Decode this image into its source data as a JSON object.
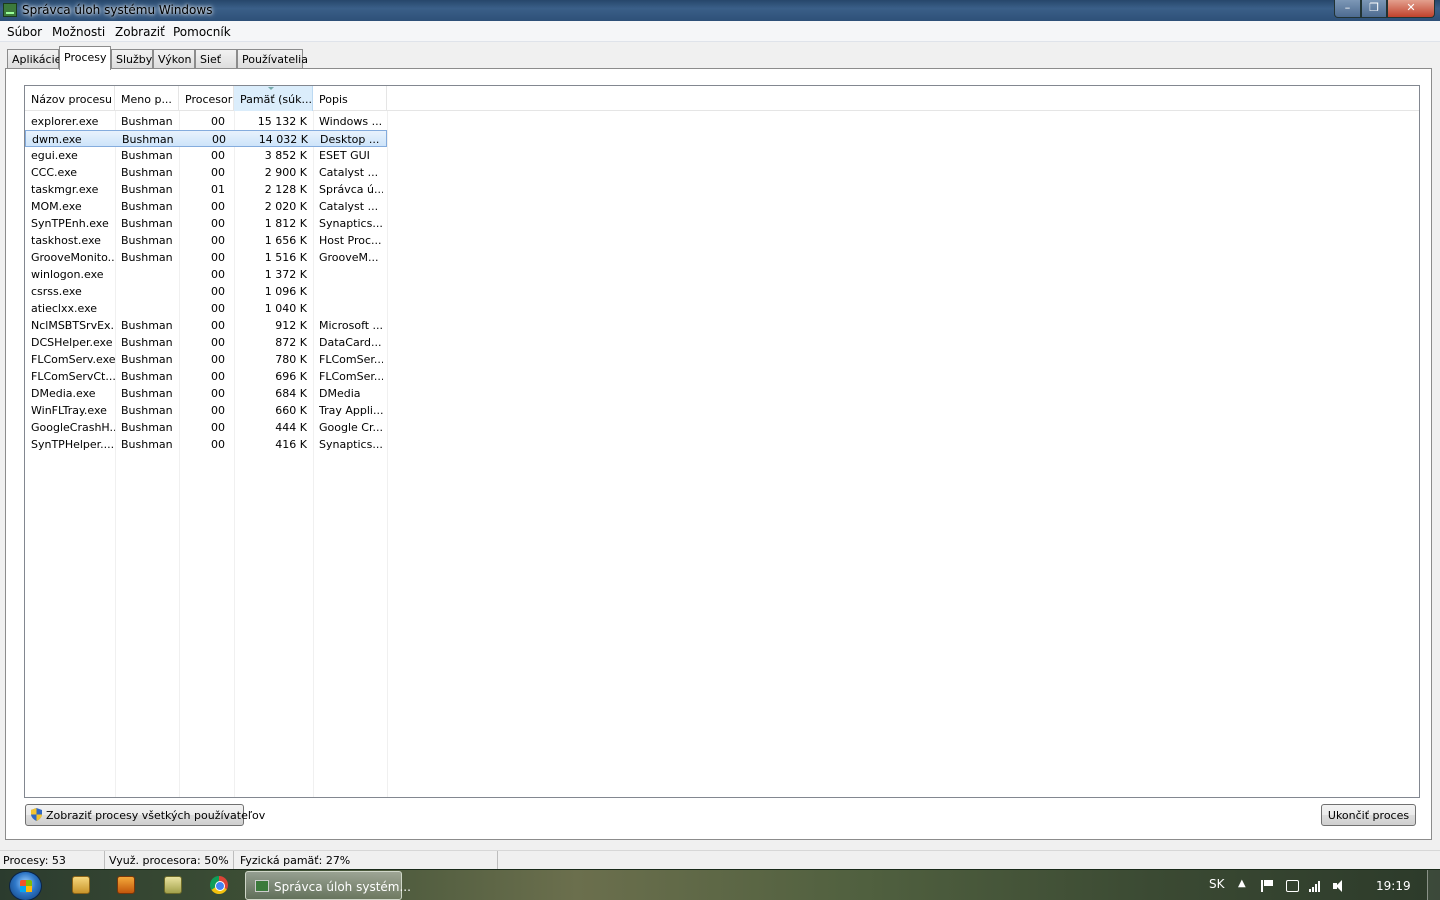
{
  "window": {
    "title": "Správca úloh systému Windows"
  },
  "menu": [
    "Súbor",
    "Možnosti",
    "Zobraziť",
    "Pomocník"
  ],
  "tabs": [
    "Aplikácie",
    "Procesy",
    "Služby",
    "Výkon",
    "Sieť",
    "Používatelia"
  ],
  "active_tab": "Procesy",
  "columns": [
    "Názov procesu",
    "Meno p...",
    "Procesor",
    "Pamäť (súk...",
    "Popis"
  ],
  "sorted_column": "Pamäť (súk...",
  "processes": [
    {
      "name": "explorer.exe",
      "user": "Bushman",
      "cpu": "00",
      "memory": "15 132 K",
      "description": "Windows ..."
    },
    {
      "name": "dwm.exe",
      "user": "Bushman",
      "cpu": "00",
      "memory": "14 032 K",
      "description": "Desktop ..."
    },
    {
      "name": "egui.exe",
      "user": "Bushman",
      "cpu": "00",
      "memory": "3 852 K",
      "description": "ESET GUI"
    },
    {
      "name": "CCC.exe",
      "user": "Bushman",
      "cpu": "00",
      "memory": "2 900 K",
      "description": "Catalyst ..."
    },
    {
      "name": "taskmgr.exe",
      "user": "Bushman",
      "cpu": "01",
      "memory": "2 128 K",
      "description": "Správca ú..."
    },
    {
      "name": "MOM.exe",
      "user": "Bushman",
      "cpu": "00",
      "memory": "2 020 K",
      "description": "Catalyst ..."
    },
    {
      "name": "SynTPEnh.exe",
      "user": "Bushman",
      "cpu": "00",
      "memory": "1 812 K",
      "description": "Synaptics..."
    },
    {
      "name": "taskhost.exe",
      "user": "Bushman",
      "cpu": "00",
      "memory": "1 656 K",
      "description": "Host Proc..."
    },
    {
      "name": "GrooveMonito...",
      "user": "Bushman",
      "cpu": "00",
      "memory": "1 516 K",
      "description": "GrooveM..."
    },
    {
      "name": "winlogon.exe",
      "user": "",
      "cpu": "00",
      "memory": "1 372 K",
      "description": ""
    },
    {
      "name": "csrss.exe",
      "user": "",
      "cpu": "00",
      "memory": "1 096 K",
      "description": ""
    },
    {
      "name": "atieclxx.exe",
      "user": "",
      "cpu": "00",
      "memory": "1 040 K",
      "description": ""
    },
    {
      "name": "NclMSBTSrvEx...",
      "user": "Bushman",
      "cpu": "00",
      "memory": "912 K",
      "description": "Microsoft ..."
    },
    {
      "name": "DCSHelper.exe",
      "user": "Bushman",
      "cpu": "00",
      "memory": "872 K",
      "description": "DataCard..."
    },
    {
      "name": "FLComServ.exe",
      "user": "Bushman",
      "cpu": "00",
      "memory": "780 K",
      "description": "FLComSer..."
    },
    {
      "name": "FLComServCt...",
      "user": "Bushman",
      "cpu": "00",
      "memory": "696 K",
      "description": "FLComSer..."
    },
    {
      "name": "DMedia.exe",
      "user": "Bushman",
      "cpu": "00",
      "memory": "684 K",
      "description": "DMedia"
    },
    {
      "name": "WinFLTray.exe",
      "user": "Bushman",
      "cpu": "00",
      "memory": "660 K",
      "description": "Tray Appli..."
    },
    {
      "name": "GoogleCrashH...",
      "user": "Bushman",
      "cpu": "00",
      "memory": "444 K",
      "description": "Google Cr..."
    },
    {
      "name": "SynTPHelper....",
      "user": "Bushman",
      "cpu": "00",
      "memory": "416 K",
      "description": "Synaptics..."
    }
  ],
  "selected_process": "dwm.exe",
  "buttons": {
    "show_all": "Zobraziť procesy všetkých používateľov",
    "end_process": "Ukončiť proces"
  },
  "status": {
    "processes": "Procesy: 53",
    "cpu": "Využ. procesora: 50%",
    "memory": "Fyzická pamäť: 27%"
  },
  "taskbar": {
    "active_task": "Správca úloh systém...",
    "language": "SK",
    "clock": "19:19"
  },
  "icons": [
    "task-manager-icon",
    "windows-start-icon",
    "explorer-icon",
    "media-player-icon",
    "libraries-icon",
    "chrome-icon",
    "shield-icon",
    "flag-icon",
    "power-icon",
    "network-icon",
    "volume-icon"
  ]
}
